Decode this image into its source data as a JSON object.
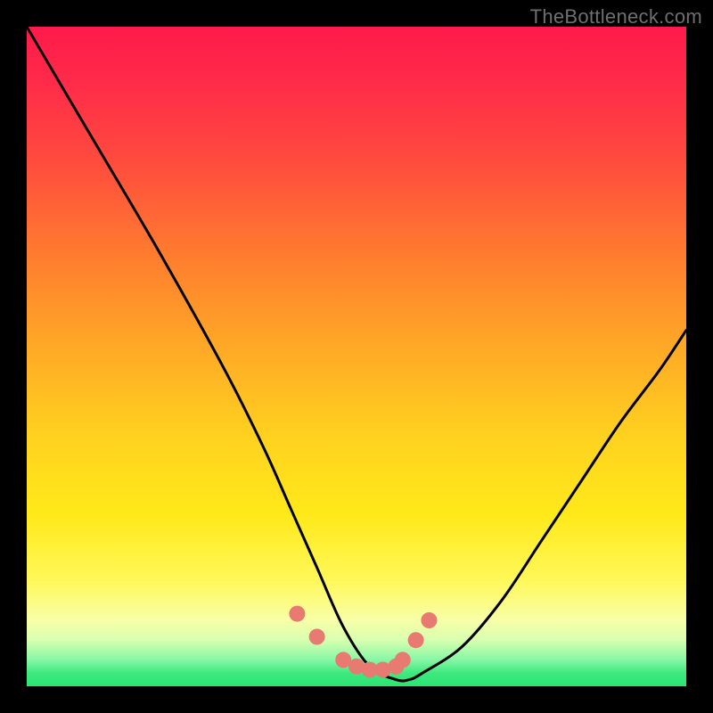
{
  "watermark": "TheBottleneck.com",
  "chart_data": {
    "type": "line",
    "title": "",
    "xlabel": "",
    "ylabel": "",
    "xlim": [
      0,
      100
    ],
    "ylim": [
      0,
      100
    ],
    "series": [
      {
        "name": "bottleneck-curve",
        "x": [
          0,
          10,
          20,
          30,
          36,
          40,
          44,
          48,
          52,
          56,
          58,
          60,
          66,
          72,
          78,
          84,
          90,
          96,
          100
        ],
        "values": [
          100,
          83,
          66,
          48,
          36,
          27,
          18,
          9,
          3,
          1,
          1,
          2,
          6,
          13,
          22,
          31,
          40,
          48,
          54
        ]
      }
    ],
    "markers": {
      "name": "bottleneck-markers",
      "x": [
        41,
        44,
        48,
        50,
        52,
        54,
        56,
        57,
        59,
        61
      ],
      "values": [
        11,
        7.5,
        4,
        3,
        2.5,
        2.5,
        3,
        4,
        7,
        10
      ],
      "color": "#e87a72",
      "radius_px": 9
    },
    "gradient_stops": [
      {
        "pos": 0.0,
        "color": "#ff1a4b"
      },
      {
        "pos": 0.2,
        "color": "#ff4a3e"
      },
      {
        "pos": 0.48,
        "color": "#ffa726"
      },
      {
        "pos": 0.74,
        "color": "#ffe91a"
      },
      {
        "pos": 0.9,
        "color": "#f8ffa8"
      },
      {
        "pos": 0.96,
        "color": "#86f7a5"
      },
      {
        "pos": 1.0,
        "color": "#29e574"
      }
    ]
  }
}
